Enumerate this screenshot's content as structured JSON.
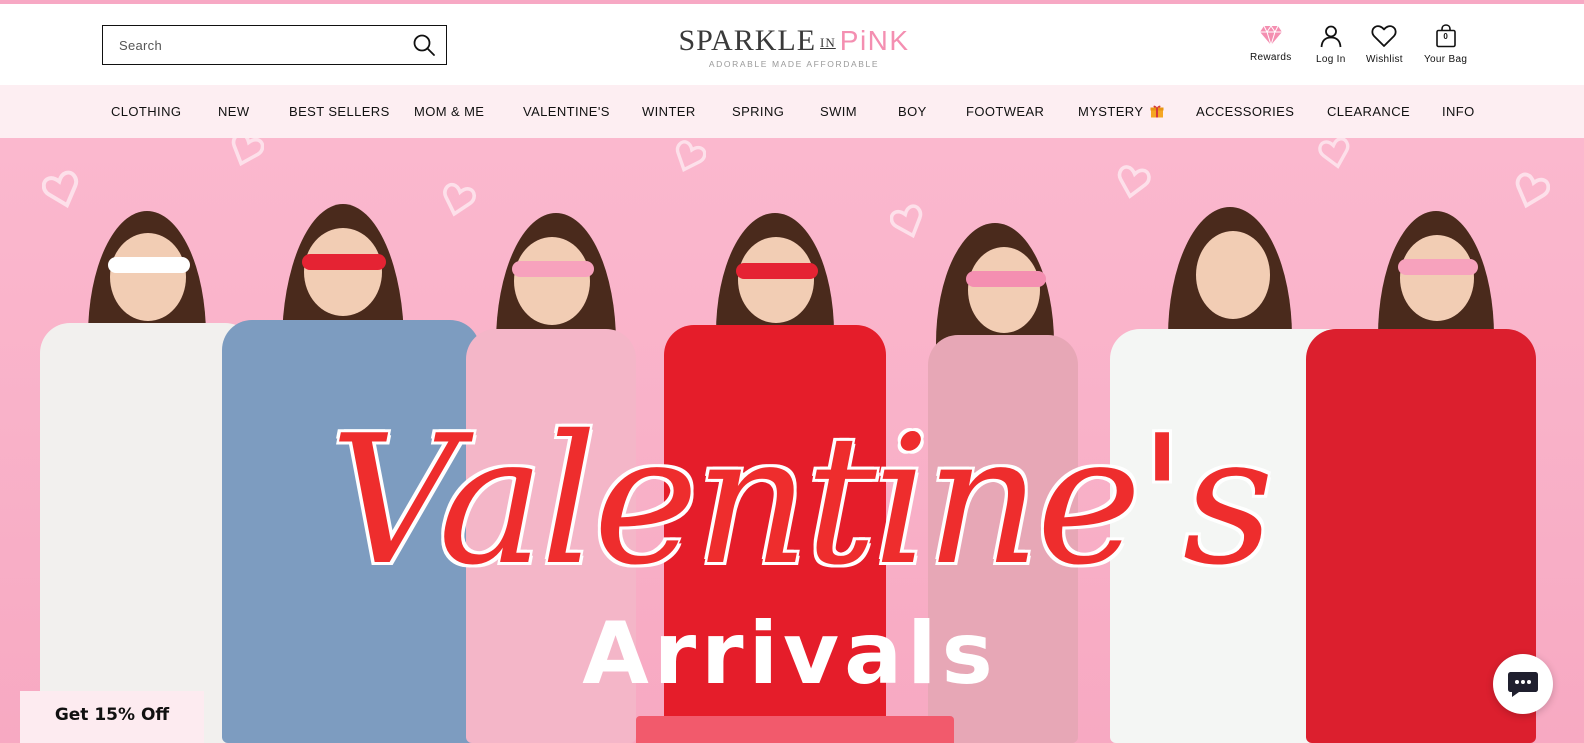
{
  "colors": {
    "brand_pink": "#f48fb1",
    "nav_bg": "#fdeef2",
    "hero_red": "#ee2d2d",
    "cta_red": "#f25a6c"
  },
  "search": {
    "placeholder": "Search",
    "icon": "search-icon"
  },
  "logo": {
    "word1": "SPARKLE",
    "word2": "IN",
    "word3": "PiNK",
    "tagline": "ADORABLE MADE AFFORDABLE"
  },
  "header_actions": [
    {
      "label": "Rewards",
      "icon": "diamond-icon"
    },
    {
      "label": "Log In",
      "icon": "user-icon"
    },
    {
      "label": "Wishlist",
      "icon": "heart-icon"
    },
    {
      "label": "Your Bag",
      "icon": "bag-icon",
      "count": "0"
    }
  ],
  "nav": {
    "items": [
      {
        "label": "CLOTHING"
      },
      {
        "label": "NEW"
      },
      {
        "label": "BEST SELLERS"
      },
      {
        "label": "MOM & ME"
      },
      {
        "label": "VALENTINE'S"
      },
      {
        "label": "WINTER"
      },
      {
        "label": "SPRING"
      },
      {
        "label": "SWIM"
      },
      {
        "label": "BOY"
      },
      {
        "label": "FOOTWEAR"
      },
      {
        "label": "MYSTERY",
        "icon": "gift-icon"
      },
      {
        "label": "ACCESSORIES"
      },
      {
        "label": "CLEARANCE"
      },
      {
        "label": "INFO"
      }
    ]
  },
  "hero": {
    "headline": "Valentine's",
    "subheadline": "Arrivals"
  },
  "promo": {
    "discount_label": "Get 15% Off"
  },
  "chat": {
    "icon": "chat-icon"
  }
}
